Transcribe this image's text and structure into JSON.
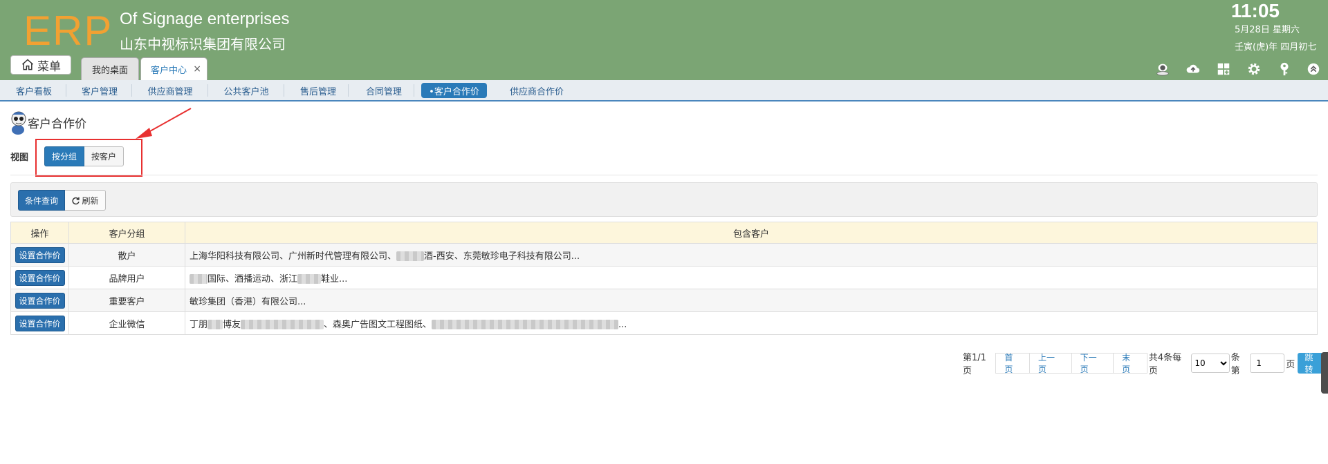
{
  "header": {
    "logo": "ERP",
    "company_en": "Of Signage enterprises",
    "company_cn": "山东中视标识集团有限公司",
    "time": "11:05",
    "date": "5月28日 星期六",
    "lunar": "壬寅(虎)年 四月初七",
    "menu_label": "菜单",
    "tabs": [
      {
        "label": "我的桌面"
      },
      {
        "label": "客户中心",
        "close": "×"
      }
    ],
    "icons": [
      "user-icon",
      "cloud-icon",
      "apps-icon",
      "gear-icon",
      "key-icon",
      "collapse-icon"
    ]
  },
  "subnav": {
    "items": [
      "客户看板",
      "客户管理",
      "供应商管理",
      "公共客户池",
      "售后管理",
      "合同管理",
      "•客户合作价",
      "供应商合作价"
    ],
    "active_index": 6
  },
  "page": {
    "title": "客户合作价",
    "view_label": "视图",
    "view_options": [
      "按分组",
      "按客户"
    ]
  },
  "toolbar": {
    "query_label": "条件查询",
    "refresh_label": "刷新"
  },
  "table": {
    "headers": [
      "操作",
      "客户分组",
      "包含客户"
    ],
    "action_label": "设置合作价",
    "rows": [
      {
        "group": "散户",
        "customers": [
          "上海华阳科技有限公司、广州新时代管理有限公司、",
          "酒-西安、东莞敏珍电子科技有限公司..."
        ]
      },
      {
        "group": "品牌用户",
        "customers": [
          "",
          "国际、酒播运动、浙江",
          "鞋业..."
        ]
      },
      {
        "group": "重要客户",
        "customers": [
          "敏珍集团（香港）有限公司..."
        ]
      },
      {
        "group": "企业微信",
        "customers": [
          "丁朋",
          "博友",
          "、森奥广告图文工程图纸、",
          "..."
        ]
      }
    ]
  },
  "pagination": {
    "page_info": "第1/1页",
    "first": "首页",
    "prev": "上一页",
    "next": "下一页",
    "last": "末页",
    "total_text": "共4条每页",
    "page_size": "10",
    "per_unit": "条第",
    "jump_value": "1",
    "page_unit": "页",
    "jump_label": "跳转"
  },
  "colors": {
    "header_bg": "#7ba574",
    "logo": "#f2a132",
    "primary": "#2a6fad",
    "annotation": "#e83030"
  }
}
